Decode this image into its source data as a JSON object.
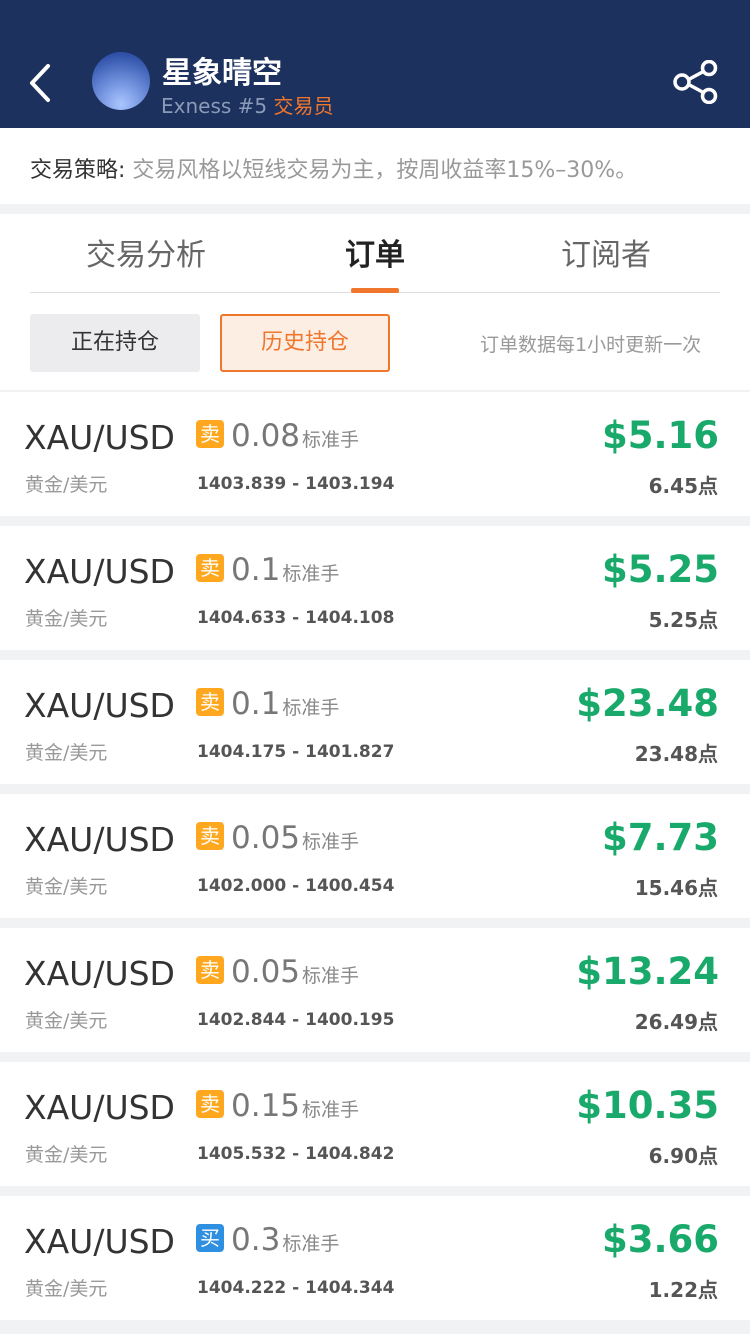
{
  "header": {
    "trader_name": "星象晴空",
    "broker": "Exness #5 ",
    "role": "交易员"
  },
  "strategy": {
    "label": "交易策略: ",
    "text": "交易风格以短线交易为主，按周收益率15%–30%。"
  },
  "tabs": [
    {
      "label": "交易分析"
    },
    {
      "label": "订单"
    },
    {
      "label": "订阅者"
    }
  ],
  "filters": {
    "open_label": "正在持仓",
    "history_label": "历史持仓",
    "update_note": "订单数据每1小时更新一次"
  },
  "colors": {
    "header_bg": "#1c315d",
    "accent": "#f0762c",
    "profit": "#19a96b",
    "sell": "#ffa81f",
    "buy": "#2f8fe0"
  },
  "orders": [
    {
      "symbol": "XAU/USD",
      "symbol_cn": "黄金/美元",
      "side": "卖",
      "side_type": "sell",
      "lots": "0.08",
      "unit": "标准手",
      "prices": "1403.839 - 1403.194",
      "profit": "$5.16",
      "points": "6.45点"
    },
    {
      "symbol": "XAU/USD",
      "symbol_cn": "黄金/美元",
      "side": "卖",
      "side_type": "sell",
      "lots": "0.1",
      "unit": "标准手",
      "prices": "1404.633 - 1404.108",
      "profit": "$5.25",
      "points": "5.25点"
    },
    {
      "symbol": "XAU/USD",
      "symbol_cn": "黄金/美元",
      "side": "卖",
      "side_type": "sell",
      "lots": "0.1",
      "unit": "标准手",
      "prices": "1404.175 - 1401.827",
      "profit": "$23.48",
      "points": "23.48点"
    },
    {
      "symbol": "XAU/USD",
      "symbol_cn": "黄金/美元",
      "side": "卖",
      "side_type": "sell",
      "lots": "0.05",
      "unit": "标准手",
      "prices": "1402.000 - 1400.454",
      "profit": "$7.73",
      "points": "15.46点"
    },
    {
      "symbol": "XAU/USD",
      "symbol_cn": "黄金/美元",
      "side": "卖",
      "side_type": "sell",
      "lots": "0.05",
      "unit": "标准手",
      "prices": "1402.844 - 1400.195",
      "profit": "$13.24",
      "points": "26.49点"
    },
    {
      "symbol": "XAU/USD",
      "symbol_cn": "黄金/美元",
      "side": "卖",
      "side_type": "sell",
      "lots": "0.15",
      "unit": "标准手",
      "prices": "1405.532 - 1404.842",
      "profit": "$10.35",
      "points": "6.90点"
    },
    {
      "symbol": "XAU/USD",
      "symbol_cn": "黄金/美元",
      "side": "买",
      "side_type": "buy",
      "lots": "0.3",
      "unit": "标准手",
      "prices": "1404.222 - 1404.344",
      "profit": "$3.66",
      "points": "1.22点"
    }
  ]
}
